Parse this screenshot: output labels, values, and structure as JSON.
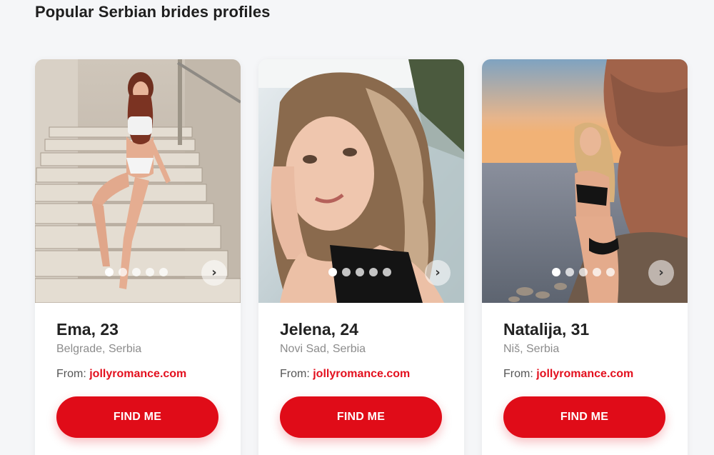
{
  "section": {
    "title": "Popular Serbian brides profiles"
  },
  "profiles": [
    {
      "name_age": "Ema, 23",
      "location": "Belgrade, Serbia",
      "from_label": "From:",
      "site": "jollyromance.com",
      "cta": "FIND ME",
      "photo_icon": "photo-woman-on-stairs",
      "slides": 5,
      "active_slide": 1
    },
    {
      "name_age": "Jelena, 24",
      "location": "Novi Sad, Serbia",
      "from_label": "From:",
      "site": "jollyromance.com",
      "cta": "FIND ME",
      "photo_icon": "photo-woman-selfie",
      "slides": 5,
      "active_slide": 1
    },
    {
      "name_age": "Natalija, 31",
      "location": "Niš, Serbia",
      "from_label": "From:",
      "site": "jollyromance.com",
      "cta": "FIND ME",
      "photo_icon": "photo-woman-on-beach",
      "slides": 5,
      "active_slide": 1
    }
  ],
  "colors": {
    "accent": "#e00c18",
    "link": "#e3101e",
    "background": "#f5f6f8"
  },
  "icons": {
    "next": "chevron-right-icon"
  }
}
